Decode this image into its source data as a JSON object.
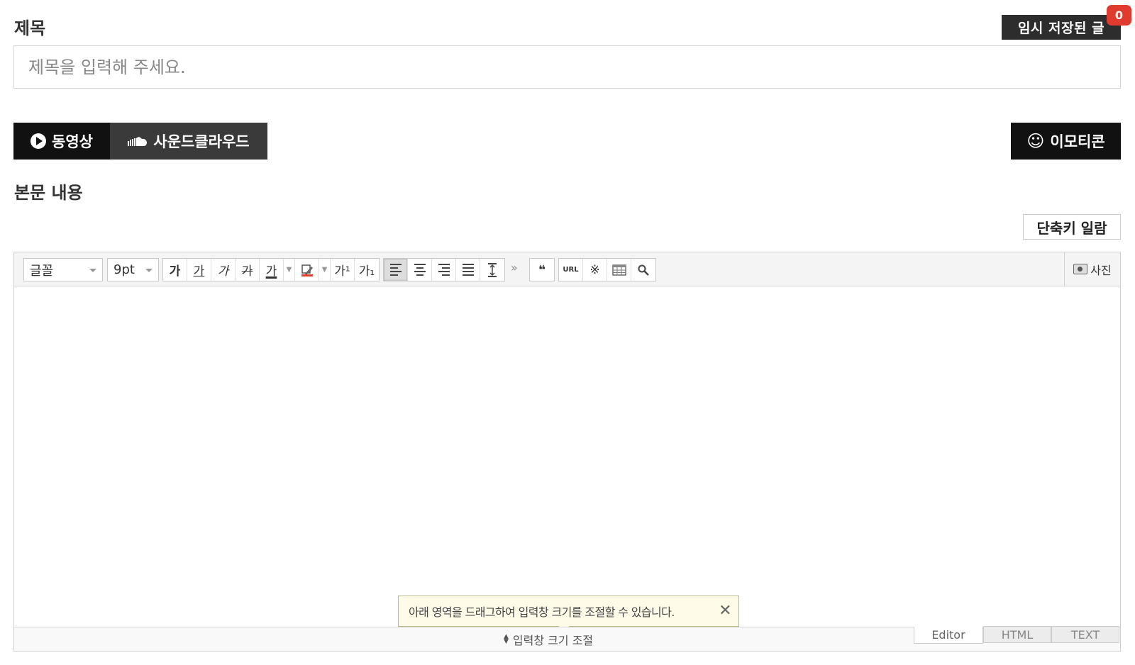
{
  "title_section": {
    "label": "제목",
    "input_placeholder": "제목을 입력해 주세요.",
    "temp_save_label": "임시 저장된 글",
    "temp_save_count": "0"
  },
  "media_buttons": {
    "video_label": "동영상",
    "soundcloud_label": "사운드클라우드",
    "emoticon_label": "이모티콘"
  },
  "body_section": {
    "label": "본문 내용",
    "shortcut_label": "단축키 일람"
  },
  "toolbar": {
    "font_select": "글꼴",
    "size_select": "9pt",
    "bold": "가",
    "underline": "가",
    "italic": "가",
    "strike": "가",
    "font_color": "가",
    "superscript": "가¹",
    "subscript": "가₁",
    "more": "»",
    "quote": "❝",
    "url": "URL",
    "special_char": "※",
    "search": "🔍",
    "photo_label": "사진"
  },
  "editor": {
    "resize_tip": "아래 영역을 드래그하여 입력창 크기를 조절할 수 있습니다.",
    "resize_handle_label": "입력창 크기 조절",
    "mode_tabs": [
      "Editor",
      "HTML",
      "TEXT"
    ],
    "active_mode": "Editor"
  },
  "colors": {
    "accent_red": "#e03b2f",
    "button_dark": "#111111",
    "button_gray": "#3a3a3a"
  }
}
